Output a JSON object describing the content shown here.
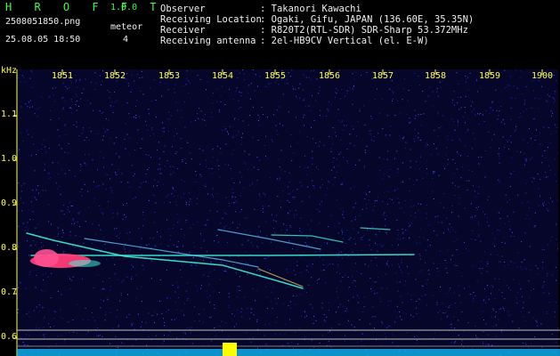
{
  "header": {
    "app_title": "H R O F F T",
    "version": "1.0.0",
    "filename": "2508051850.png",
    "datetime": "25.08.05 18:50",
    "meteor_label": "meteor",
    "meteor_count": "4"
  },
  "info": [
    {
      "key": "Observer",
      "value": ": Takanori Kawachi"
    },
    {
      "key": "Receiving Location",
      "value": ": Ogaki, Gifu, JAPAN (136.60E, 35.35N)"
    },
    {
      "key": "Receiver",
      "value": ": R820T2(RTL-SDR) SDR-Sharp 53.372MHz"
    },
    {
      "key": "Receiving antenna",
      "value": ": 2el-HB9CV Vertical (el. E-W)"
    }
  ],
  "axes": {
    "y_unit": "kHz",
    "x_ticks": [
      "1851",
      "1852",
      "1853",
      "1854",
      "1855",
      "1856",
      "1857",
      "1858",
      "1859",
      "1900"
    ],
    "y_ticks": [
      "1.1",
      "1.0",
      "0.9",
      "0.8",
      "0.7",
      "0.6"
    ]
  },
  "colors": {
    "background": "#06062a",
    "text_green": "#3cff3c",
    "tick_yellow": "#ffff40",
    "trail_pink": "#ff3c78",
    "trail_cyan": "#40ffe0",
    "noise_blue": "#2040ff"
  }
}
